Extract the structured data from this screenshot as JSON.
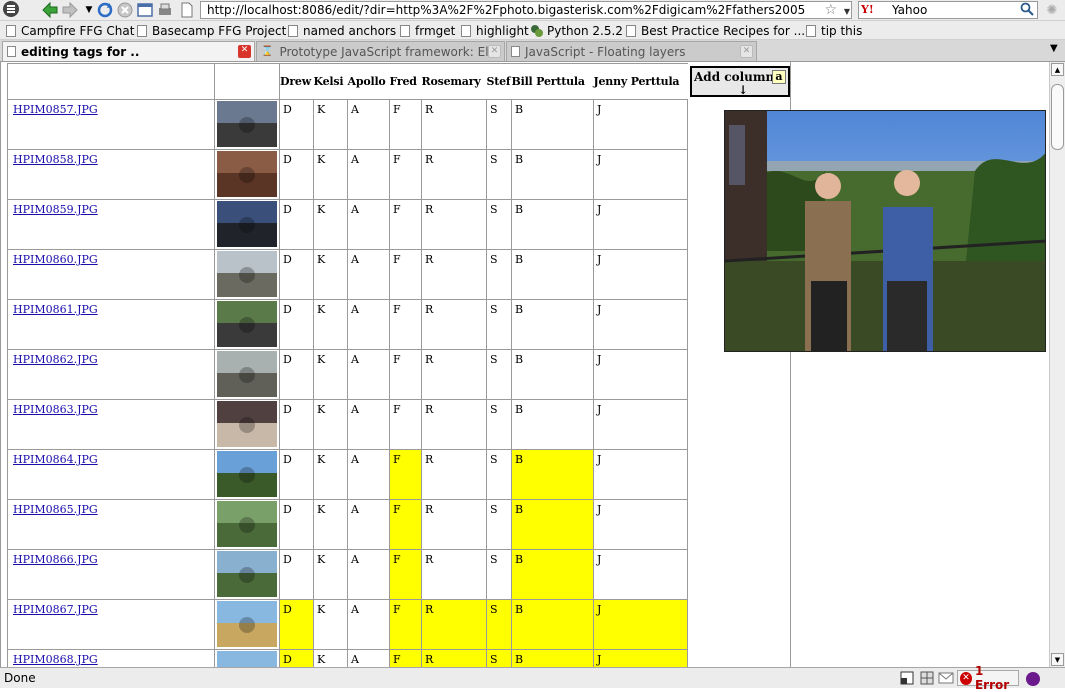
{
  "toolbar": {
    "url": "http://localhost:8086/edit/?dir=http%3A%2F%2Fphoto.bigasterisk.com%2Fdigicam%2Ffathers2005",
    "search_placeholder": "Yahoo",
    "search_engine_label": "Y!"
  },
  "bookmarks": [
    {
      "label": "Campfire FFG Chat"
    },
    {
      "label": "Basecamp FFG Project"
    },
    {
      "label": "named anchors"
    },
    {
      "label": "frmget"
    },
    {
      "label": "highlight"
    },
    {
      "label": "Python 2.5.2"
    },
    {
      "label": "Best Practice Recipes for ..."
    },
    {
      "label": "tip this"
    }
  ],
  "tabs": [
    {
      "label": "editing tags for ..",
      "active": true
    },
    {
      "label": "Prototype JavaScript framework: El..."
    },
    {
      "label": "JavaScript - Floating layers"
    }
  ],
  "table": {
    "columns": [
      "Drew",
      "Kelsi",
      "Apollo",
      "Fred",
      "Rosemary",
      "Stef",
      "Bill  Perttula",
      "Jenny  Perttula"
    ],
    "tag_letters": [
      "D",
      "K",
      "A",
      "F",
      "R",
      "S",
      "B",
      "J"
    ],
    "add_column_label": "Add column",
    "add_column_arrow": "↓",
    "add_column_key": "a",
    "rows": [
      {
        "file": "HPIM0857.JPG",
        "on": [
          0,
          0,
          0,
          0,
          0,
          0,
          0,
          0
        ],
        "thumb": [
          "#6a7890",
          "#3a3a3a"
        ]
      },
      {
        "file": "HPIM0858.JPG",
        "on": [
          0,
          0,
          0,
          0,
          0,
          0,
          0,
          0
        ],
        "thumb": [
          "#8a5b45",
          "#5a3424"
        ]
      },
      {
        "file": "HPIM0859.JPG",
        "on": [
          0,
          0,
          0,
          0,
          0,
          0,
          0,
          0
        ],
        "thumb": [
          "#3a4f7a",
          "#20242a"
        ]
      },
      {
        "file": "HPIM0860.JPG",
        "on": [
          0,
          0,
          0,
          0,
          0,
          0,
          0,
          0
        ],
        "thumb": [
          "#b8c2c8",
          "#6a6a60"
        ]
      },
      {
        "file": "HPIM0861.JPG",
        "on": [
          0,
          0,
          0,
          0,
          0,
          0,
          0,
          0
        ],
        "thumb": [
          "#5a7a4a",
          "#3a3a3a"
        ]
      },
      {
        "file": "HPIM0862.JPG",
        "on": [
          0,
          0,
          0,
          0,
          0,
          0,
          0,
          0
        ],
        "thumb": [
          "#a8b0b0",
          "#606058"
        ]
      },
      {
        "file": "HPIM0863.JPG",
        "on": [
          0,
          0,
          0,
          0,
          0,
          0,
          0,
          0
        ],
        "thumb": [
          "#504040",
          "#c8b8a8"
        ]
      },
      {
        "file": "HPIM0864.JPG",
        "on": [
          0,
          0,
          0,
          1,
          0,
          0,
          1,
          0
        ],
        "thumb": [
          "#6aa0d8",
          "#3a5a2a"
        ]
      },
      {
        "file": "HPIM0865.JPG",
        "on": [
          0,
          0,
          0,
          1,
          0,
          0,
          1,
          0
        ],
        "thumb": [
          "#7aa06a",
          "#4a6a3a"
        ]
      },
      {
        "file": "HPIM0866.JPG",
        "on": [
          0,
          0,
          0,
          1,
          0,
          0,
          1,
          0
        ],
        "thumb": [
          "#8ab0d0",
          "#4a6a3a"
        ]
      },
      {
        "file": "HPIM0867.JPG",
        "on": [
          1,
          0,
          0,
          1,
          1,
          1,
          1,
          1
        ],
        "thumb": [
          "#88b8e0",
          "#c8a860"
        ]
      },
      {
        "file": "HPIM0868.JPG",
        "on": [
          1,
          0,
          0,
          1,
          1,
          1,
          1,
          1
        ],
        "thumb": [
          "#88b8e0",
          "#6a6a6a"
        ]
      }
    ]
  },
  "status": {
    "text": "Done",
    "error_label": "1 Error"
  }
}
